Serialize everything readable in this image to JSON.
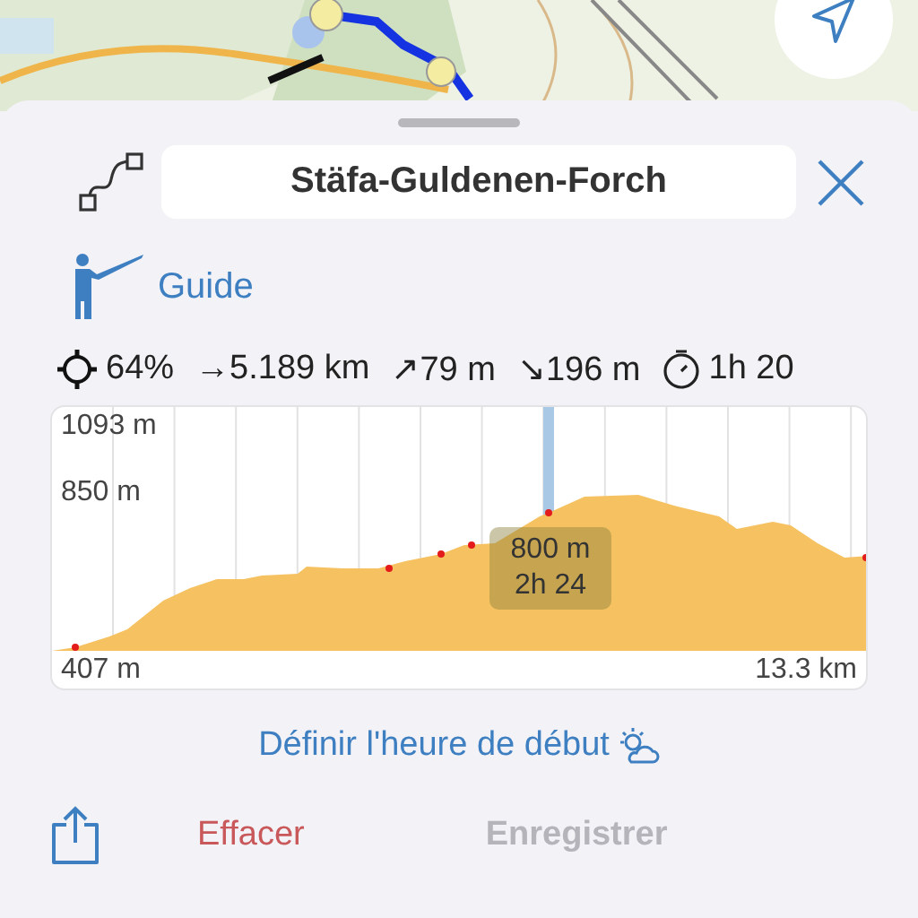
{
  "route": {
    "title": "Stäfa-Guldenen-Forch"
  },
  "guide": {
    "label": "Guide"
  },
  "stats": [
    {
      "kind": "crosshair",
      "text": "64%"
    },
    {
      "kind": "plain",
      "text": "→5.189 km"
    },
    {
      "kind": "plain",
      "text": "↗79 m"
    },
    {
      "kind": "plain",
      "text": "↘196 m"
    },
    {
      "kind": "stopwatch",
      "text": "1h 20"
    }
  ],
  "profile": {
    "max_label": "1093 m",
    "mid_label": "850 m",
    "min_label": "407 m",
    "distance_label": "13.3 km",
    "tooltip": [
      "800 m",
      "2h 24"
    ]
  },
  "start_time": {
    "label": "Définir l'heure de début"
  },
  "actions": [
    {
      "kind": "delete",
      "label": "Effacer",
      "disabled": false
    },
    {
      "kind": "save",
      "label": "Enregistrer",
      "disabled": true
    }
  ]
}
